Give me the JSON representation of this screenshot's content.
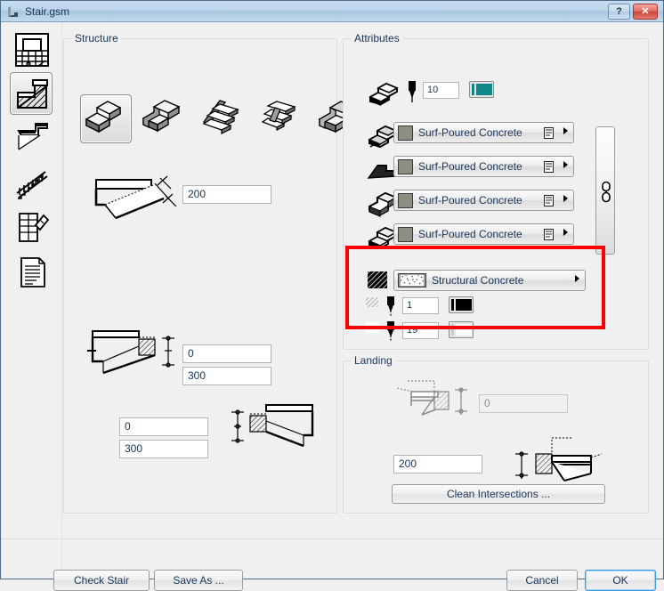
{
  "window": {
    "title": "Stair.gsm",
    "app_icon": "stair-app-icon",
    "help_label": "?",
    "close_label": "✕"
  },
  "sidebar": {
    "items": [
      {
        "name": "sidebar-item-plan-view",
        "icon": "stair-plan-icon",
        "selected": false
      },
      {
        "name": "sidebar-item-structure",
        "icon": "stair-structure-icon",
        "selected": true
      },
      {
        "name": "sidebar-item-tread",
        "icon": "stair-tread-icon",
        "selected": false
      },
      {
        "name": "sidebar-item-railing",
        "icon": "stair-railing-icon",
        "selected": false
      },
      {
        "name": "sidebar-item-geometry",
        "icon": "stair-geometry-icon",
        "selected": false
      },
      {
        "name": "sidebar-item-listing",
        "icon": "document-lines-icon",
        "selected": false
      }
    ]
  },
  "structure": {
    "title": "Structure",
    "type_buttons": [
      {
        "name": "structure-type-1",
        "icon": "stair-type-monolith-icon",
        "selected": true
      },
      {
        "name": "structure-type-2",
        "icon": "stair-type-stringer-icon",
        "selected": false
      },
      {
        "name": "structure-type-3",
        "icon": "stair-type-cantilever-icon",
        "selected": false
      },
      {
        "name": "structure-type-4",
        "icon": "stair-type-spine-icon",
        "selected": false
      },
      {
        "name": "structure-type-5",
        "icon": "stair-type-solid-icon",
        "selected": false
      }
    ],
    "slab_thickness": "200",
    "upper_offset_1": "0",
    "upper_offset_2": "300",
    "lower_offset_1": "0",
    "lower_offset_2": "300"
  },
  "attributes": {
    "title": "Attributes",
    "pen": {
      "icon": "stair-3d-icon",
      "pen_icon": "pen-nib-icon",
      "value": "10",
      "swatch_color": "#0d8787",
      "bar_color": "#0d8787"
    },
    "materials": [
      {
        "name": "material-top",
        "row_icon": "stair-3d-top-icon",
        "label": "Surf-Poured Concrete",
        "swatch_color": "#8e8d82"
      },
      {
        "name": "material-side",
        "row_icon": "stair-side-icon",
        "label": "Surf-Poured Concrete",
        "swatch_color": "#8e8d82"
      },
      {
        "name": "material-bottom",
        "row_icon": "stair-bottom-icon",
        "label": "Surf-Poured Concrete",
        "swatch_color": "#8e8d82"
      },
      {
        "name": "material-end",
        "row_icon": "stair-end-icon",
        "label": "Surf-Poured Concrete",
        "swatch_color": "#8e8d82"
      }
    ],
    "link_button": {
      "name": "link-materials-button",
      "icon": "chain-link-icon"
    },
    "highlighted": {
      "fill": {
        "icon": "hatch-fill-icon",
        "label": "Structural Concrete",
        "swatch": "dotted-concrete-pattern"
      },
      "fill_pen": {
        "icon": "hatch-pen-icon",
        "value": "1",
        "swatch_color": "#000000"
      },
      "background_pen": {
        "icon": "blank-pen-icon",
        "value": "19",
        "swatch_color": "#ffffff"
      }
    }
  },
  "landing": {
    "title": "Landing",
    "upper_value": "0",
    "upper_disabled": true,
    "lower_value": "200",
    "clean_button": "Clean Intersections ..."
  },
  "footer": {
    "check_stair": "Check Stair",
    "save_as": "Save As ...",
    "cancel": "Cancel",
    "ok": "OK"
  }
}
